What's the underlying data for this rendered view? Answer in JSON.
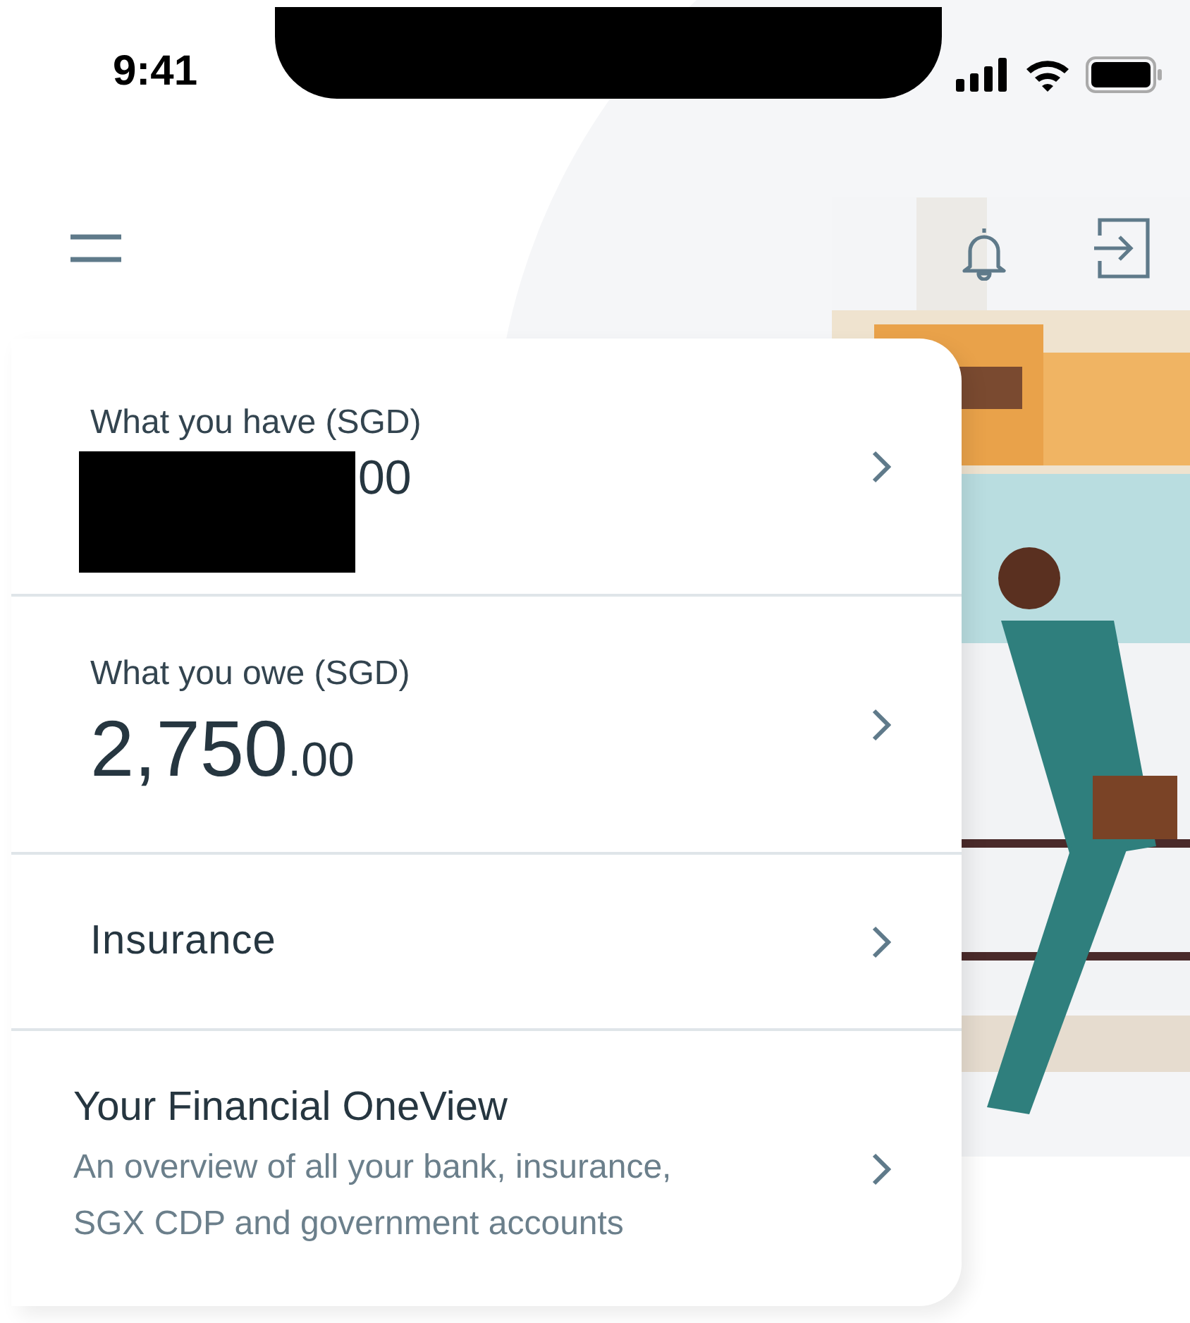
{
  "status_bar": {
    "time": "9:41"
  },
  "rows": [
    {
      "kind": "balance",
      "label": "What you have (SGD)",
      "redacted": true,
      "amount": {
        "decimal": "00"
      }
    },
    {
      "kind": "balance",
      "label": "What you owe (SGD)",
      "redacted": false,
      "amount": {
        "main": "2,750",
        "decimal": ".00"
      }
    },
    {
      "kind": "link",
      "label": "Insurance"
    },
    {
      "kind": "overview",
      "title": "Your Financial OneView",
      "description": "An overview of all your bank, insurance, SGX CDP and government accounts"
    }
  ]
}
